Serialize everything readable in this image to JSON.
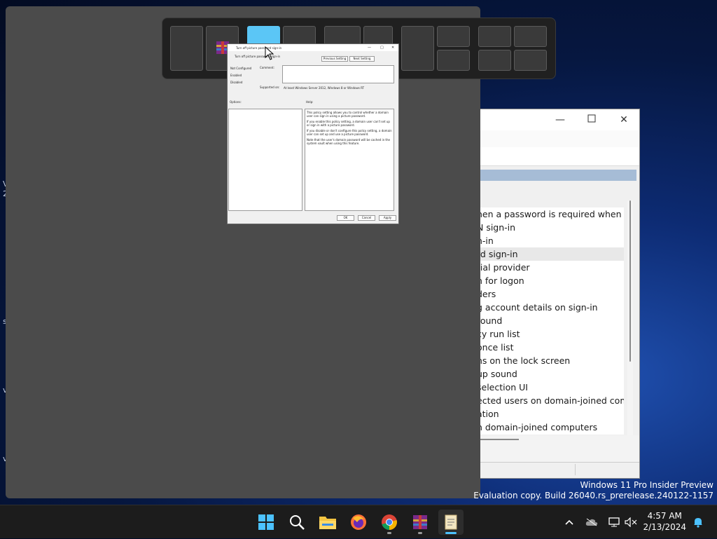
{
  "desktop_fragments": [
    "V",
    "2",
    "s",
    "v",
    "v"
  ],
  "snap_flyout": {
    "highlight_color": "#5bc6f6"
  },
  "gpedit": {
    "list_items": [
      "hen a password is required when resu...",
      "N sign-in",
      "n-in",
      "rd sign-in",
      "tial provider",
      "n for logon",
      "ders",
      "g account details on sign-in",
      "round",
      "cy run list",
      "once list",
      "ns on the lock screen",
      "up sound",
      "selection UI",
      "ected users on domain-joined com...",
      "ation",
      "n domain-joined computers"
    ],
    "selected_index": 3
  },
  "dialog": {
    "title": "Turn off picture password sign-in",
    "setting_name": "Turn off picture password sign-in",
    "prev_button": "Previous Setting",
    "next_button": "Next Setting",
    "radio_not_configured": "Not Configured",
    "radio_enabled": "Enabled",
    "radio_disabled": "Disabled",
    "comment_label": "Comment:",
    "supported_label": "Supported on:",
    "supported_value": "At least Windows Server 2012, Windows 8 or Windows RT",
    "options_label": "Options:",
    "help_label": "Help:",
    "help_p1": "This policy setting allows you to control whether a domain user can sign in using a picture password.",
    "help_p2": "If you enable this policy setting, a domain user can't set up or sign in with a picture password.",
    "help_p3": "If you disable or don't configure this policy setting, a domain user can set up and use a picture password.",
    "help_p4": "Note that the user's domain password will be cached in the system vault when using this feature.",
    "ok_button": "OK",
    "cancel_button": "Cancel",
    "apply_button": "Apply"
  },
  "watermark": {
    "line1": "Windows 11 Pro Insider Preview",
    "line2": "Evaluation copy. Build 26040.rs_prerelease.240122-1157"
  },
  "taskbar": {
    "apps": [
      "start-icon",
      "search-icon",
      "file-explorer-icon",
      "firefox-icon",
      "chrome-icon",
      "winrar-icon",
      "notepad-icon"
    ],
    "active_app": "notepad-icon",
    "accent_color": "#4cc2ff"
  },
  "clock": {
    "time": "4:57 AM",
    "date": "2/13/2024"
  }
}
